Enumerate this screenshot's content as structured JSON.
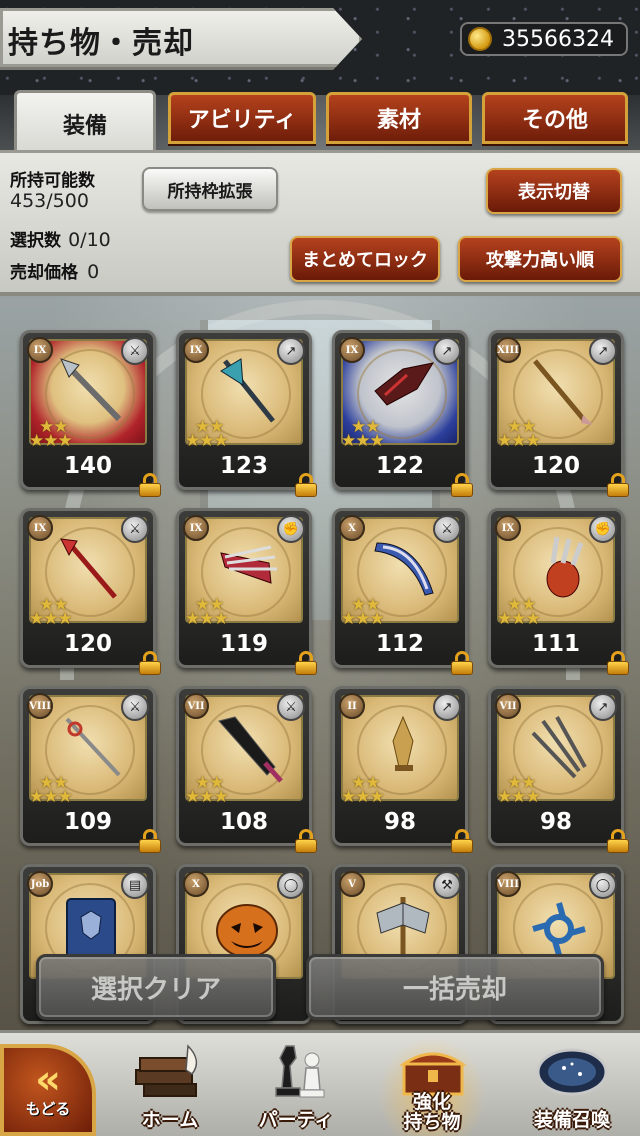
{
  "header": {
    "title": "持ち物・売却",
    "currency": "35566324"
  },
  "tabs": [
    {
      "label": "装備",
      "active": true
    },
    {
      "label": "アビリティ",
      "active": false
    },
    {
      "label": "素材",
      "active": false
    },
    {
      "label": "その他",
      "active": false
    }
  ],
  "info": {
    "capacity_label": "所持可能数",
    "capacity_value": "453/500",
    "expand_button": "所持枠拡張",
    "display_toggle_button": "表示切替",
    "selected_label": "選択数",
    "selected_value": "0/10",
    "price_label": "売却価格",
    "price_value": "0",
    "bulk_lock_button": "まとめてロック",
    "sort_button": "攻撃力高い順"
  },
  "items": [
    {
      "rank": "IX",
      "stars": 5,
      "value": "140",
      "locked": true,
      "type_icon": "sword-icon",
      "weapon": "spear",
      "frame": "red"
    },
    {
      "rank": "IX",
      "stars": 5,
      "value": "123",
      "locked": true,
      "type_icon": "spear-icon",
      "weapon": "halberd",
      "frame": "gold"
    },
    {
      "rank": "IX",
      "stars": 5,
      "value": "122",
      "locked": true,
      "type_icon": "spear-icon",
      "weapon": "blade",
      "frame": "blue"
    },
    {
      "rank": "XIII",
      "stars": 5,
      "value": "120",
      "locked": true,
      "type_icon": "spear-icon",
      "weapon": "lance",
      "frame": "gold"
    },
    {
      "rank": "IX",
      "stars": 5,
      "value": "120",
      "locked": true,
      "type_icon": "sword-icon",
      "weapon": "trident",
      "frame": "gold"
    },
    {
      "rank": "IX",
      "stars": 5,
      "value": "119",
      "locked": true,
      "type_icon": "fist-icon",
      "weapon": "claw",
      "frame": "gold"
    },
    {
      "rank": "X",
      "stars": 5,
      "value": "112",
      "locked": true,
      "type_icon": "sword-icon",
      "weapon": "scimitar",
      "frame": "gold"
    },
    {
      "rank": "IX",
      "stars": 5,
      "value": "111",
      "locked": true,
      "type_icon": "fist-icon",
      "weapon": "claw2",
      "frame": "gold"
    },
    {
      "rank": "VIII",
      "stars": 5,
      "value": "109",
      "locked": true,
      "type_icon": "sword-icon",
      "weapon": "rapier",
      "frame": "gold"
    },
    {
      "rank": "VII",
      "stars": 5,
      "value": "108",
      "locked": true,
      "type_icon": "sword-icon",
      "weapon": "greatsword",
      "frame": "gold"
    },
    {
      "rank": "II",
      "stars": 5,
      "value": "98",
      "locked": true,
      "type_icon": "spear-icon",
      "weapon": "dagger",
      "frame": "gold"
    },
    {
      "rank": "VII",
      "stars": 5,
      "value": "98",
      "locked": true,
      "type_icon": "spear-icon",
      "weapon": "knives",
      "frame": "gold"
    },
    {
      "rank": "Job",
      "stars": 0,
      "value": "",
      "locked": false,
      "type_icon": "book-icon",
      "weapon": "book",
      "frame": "gold"
    },
    {
      "rank": "X",
      "stars": 0,
      "value": "",
      "locked": false,
      "type_icon": "ring-icon",
      "weapon": "pumpkin",
      "frame": "gold"
    },
    {
      "rank": "V",
      "stars": 0,
      "value": "",
      "locked": false,
      "type_icon": "axe-icon",
      "weapon": "axe",
      "frame": "gold"
    },
    {
      "rank": "VIII",
      "stars": 0,
      "value": "",
      "locked": false,
      "type_icon": "ring-icon",
      "weapon": "shuriken",
      "frame": "gold"
    }
  ],
  "actions": {
    "clear_selection": "選択クリア",
    "bulk_sell": "一括売却"
  },
  "nav": {
    "back": "もどる",
    "back_chevrons": "«",
    "home": "ホーム",
    "party": "パーティ",
    "enhance": "強化\n持ち物",
    "summon": "装備召喚"
  },
  "colors": {
    "tab_red": "#8e2a10",
    "gold_border": "#d5a23a",
    "star": "#e0b93a",
    "lock": "#e4a11b"
  }
}
